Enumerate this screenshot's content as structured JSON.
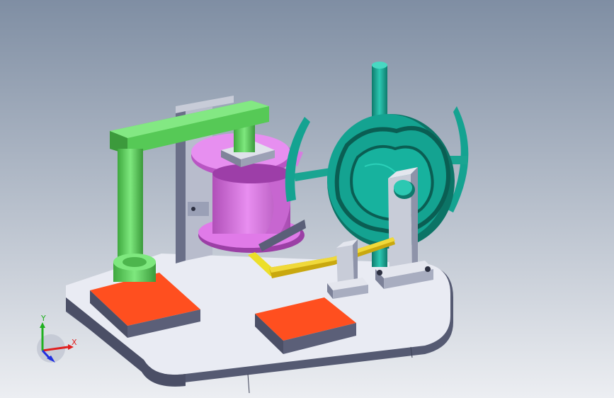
{
  "viewport": {
    "background_top": "#7f8ea3",
    "background_bottom": "#eceef2"
  },
  "triad": {
    "x_label": "X",
    "y_label": "Y",
    "x_color": "#e02020",
    "y_color": "#20b020",
    "z_color": "#2030e0"
  },
  "model": {
    "parts": [
      {
        "name": "base-plate",
        "color": "#e9ebf3"
      },
      {
        "name": "red-block",
        "color": "#ff4f1f"
      },
      {
        "name": "green-column",
        "color": "#5fd85f"
      },
      {
        "name": "pink-cylindrical-cam",
        "color": "#e07ae8"
      },
      {
        "name": "teal-disc-cam",
        "color": "#14a391"
      },
      {
        "name": "support-bracket",
        "color": "#c8ccd8"
      },
      {
        "name": "yellow-link",
        "color": "#e2c81e"
      }
    ]
  }
}
